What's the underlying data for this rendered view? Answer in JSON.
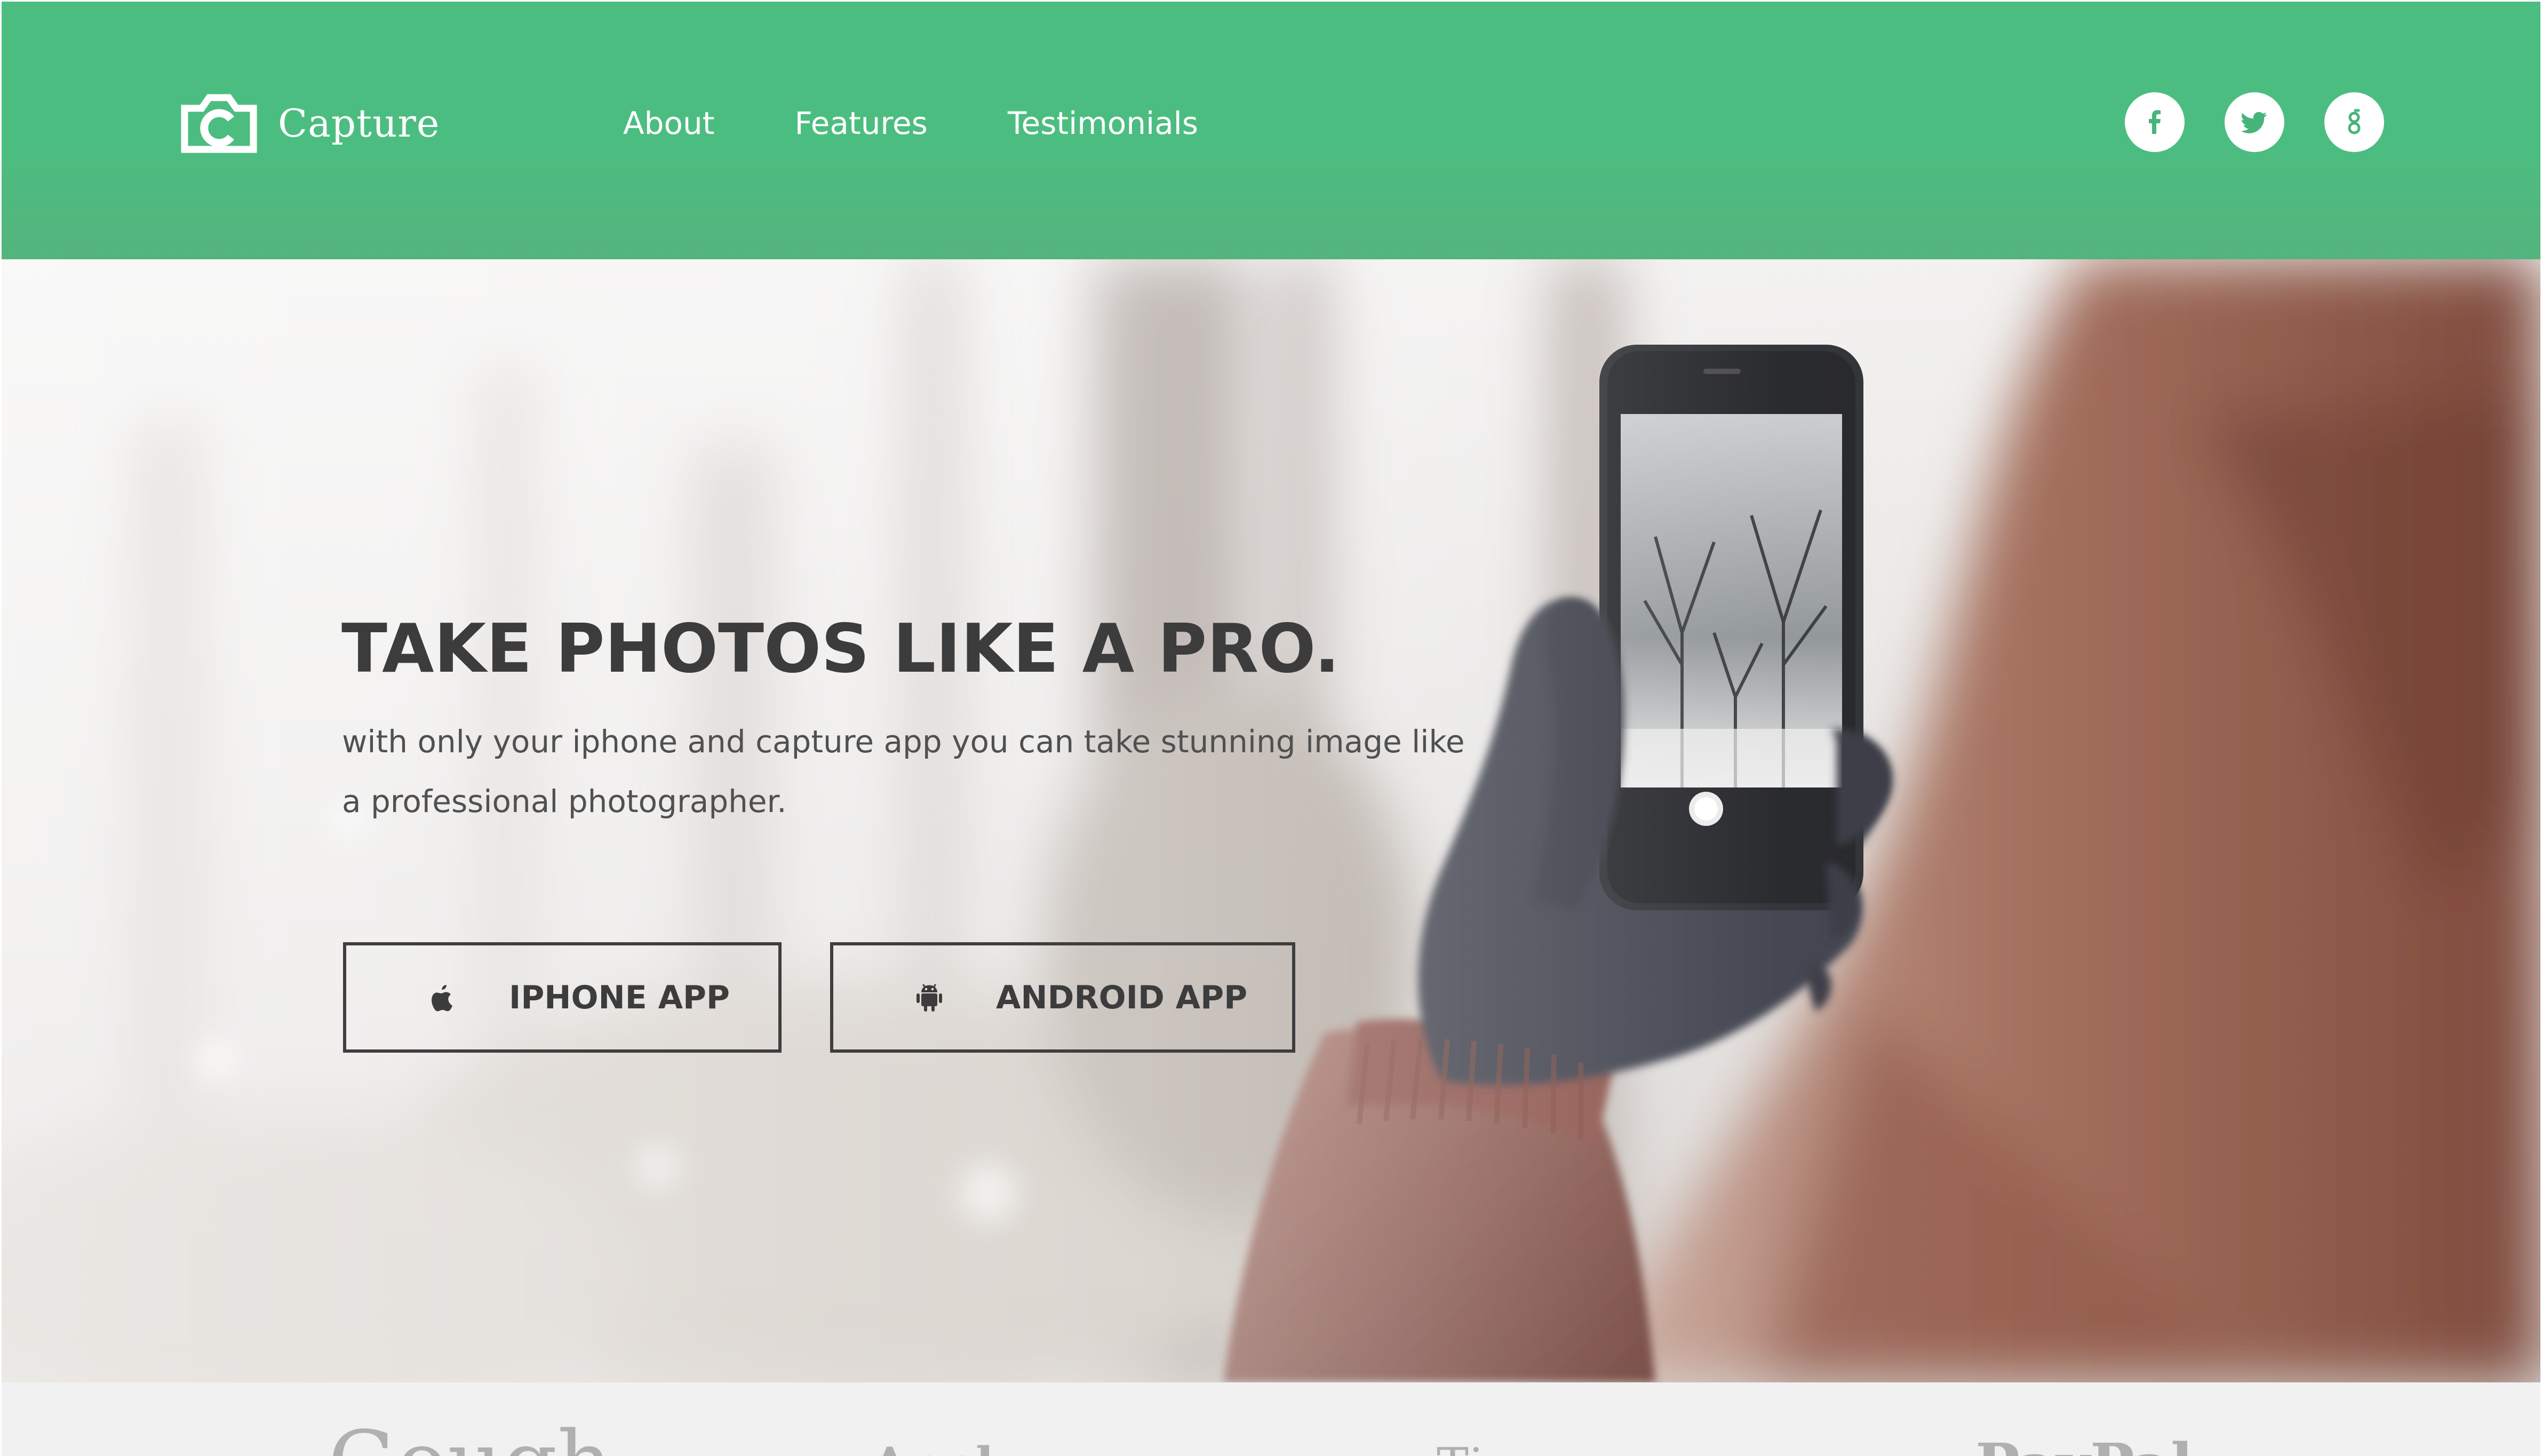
{
  "brand": {
    "name": "Capture",
    "color": "#4cbd80"
  },
  "nav": {
    "items": [
      {
        "label": "About"
      },
      {
        "label": "Features"
      },
      {
        "label": "Testimonials"
      }
    ]
  },
  "social": [
    {
      "icon": "facebook-icon"
    },
    {
      "icon": "twitter-icon"
    },
    {
      "icon": "google-plus-icon"
    }
  ],
  "hero": {
    "title": "TAKE PHOTOS LIKE A PRO.",
    "subtitle": "with only your iphone and capture app you can take stunning image like a professional photographer.",
    "buttons": [
      {
        "label": "IPHONE APP",
        "icon": "apple-icon"
      },
      {
        "label": "ANDROID APP",
        "icon": "android-icon"
      }
    ]
  },
  "press_logos": [
    "Gough",
    "Apple",
    "Times",
    "PayPal"
  ]
}
